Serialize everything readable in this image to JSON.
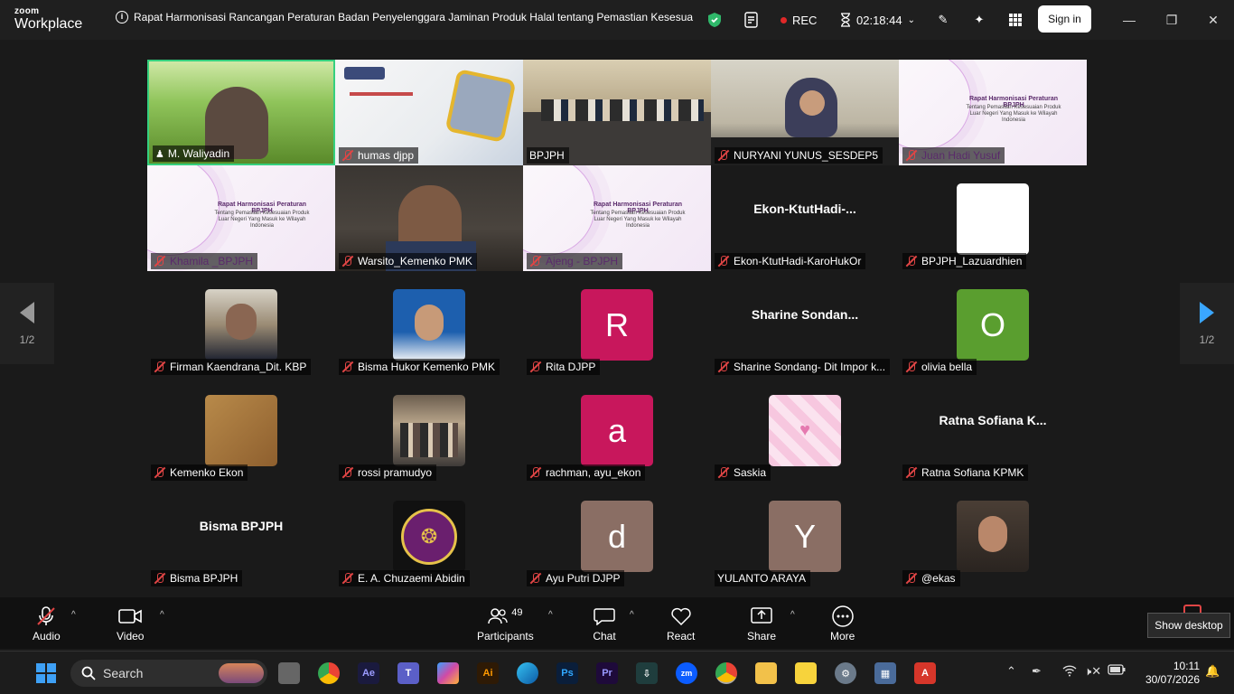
{
  "titlebar": {
    "brand_top": "zoom",
    "brand_bottom": "Workplace",
    "meeting_title": "Rapat Harmonisasi Rancangan Peraturan Badan Penyelenggara Jaminan Produk Halal tentang Pemastian Kesesua",
    "rec_label": "REC",
    "timer": "02:18:44",
    "signin_label": "Sign in"
  },
  "gallery": {
    "page_indicator": "1/2",
    "tiles": [
      {
        "name": "M. Waliyadin",
        "kind": "video"
      },
      {
        "name": "humas djpp",
        "kind": "video"
      },
      {
        "name": "BPJPH",
        "kind": "video"
      },
      {
        "name": "NURYANI YUNUS_SESDEP5",
        "kind": "video"
      },
      {
        "name": "Juan Hadi Yusuf",
        "kind": "slide"
      },
      {
        "name": "Khamila _BPJPH",
        "kind": "slide"
      },
      {
        "name": "Warsito_Kemenko PMK",
        "kind": "video"
      },
      {
        "name": "Ajeng - BPJPH",
        "kind": "slide"
      },
      {
        "name": "Ekon-KtutHadi-KaroHukOr",
        "display": "Ekon-KtutHadi-...",
        "kind": "name"
      },
      {
        "name": "BPJPH_Lazuardhien",
        "kind": "avatar",
        "color": "#ffffff",
        "letter": ""
      },
      {
        "name": "Firman Kaendrana_Dit. KBP",
        "kind": "photo"
      },
      {
        "name": "Bisma Hukor Kemenko PMK",
        "kind": "photo"
      },
      {
        "name": "Rita DJPP",
        "kind": "avatar",
        "color": "#c8175c",
        "letter": "R"
      },
      {
        "name": "Sharine Sondang- Dit Impor k...",
        "display": "Sharine  Sondan...",
        "kind": "name"
      },
      {
        "name": "olivia bella",
        "kind": "avatar",
        "color": "#5a9e2f",
        "letter": "O"
      },
      {
        "name": "Kemenko Ekon",
        "kind": "avatar",
        "color": "#a8783e",
        "letter": ""
      },
      {
        "name": "rossi pramudyo",
        "kind": "photo"
      },
      {
        "name": "rachman, ayu_ekon",
        "kind": "avatar",
        "color": "#c8175c",
        "letter": "a"
      },
      {
        "name": "Saskia",
        "kind": "avatar",
        "color": "#f4c6dd",
        "letter": ""
      },
      {
        "name": "Ratna Sofiana KPMK",
        "display": "Ratna Sofiana K...",
        "kind": "name"
      },
      {
        "name": "Bisma  BPJPH",
        "display": "Bisma  BPJPH",
        "kind": "name"
      },
      {
        "name": "E. A. Chuzaemi Abidin",
        "kind": "logo"
      },
      {
        "name": "Ayu Putri DJPP",
        "kind": "avatar",
        "color": "#8a6e64",
        "letter": "d"
      },
      {
        "name": "YULANTO ARAYA",
        "kind": "avatar",
        "color": "#8a6e64",
        "letter": "Y"
      },
      {
        "name": "@ekas",
        "kind": "photo"
      }
    ],
    "slide_text": {
      "title": "Rapat Harmonisasi Peraturan BPJPH",
      "subtitle": "Tentang Pemastian Kesesuaian Produk Luar Negeri Yang Masuk ke Wilayah Indonesia"
    }
  },
  "toolbar": {
    "audio": "Audio",
    "video": "Video",
    "participants": "Participants",
    "participants_count": "49",
    "chat": "Chat",
    "react": "React",
    "share": "Share",
    "more": "More",
    "tooltip": "Show desktop"
  },
  "taskbar": {
    "search_placeholder": "Search",
    "time": "10:11",
    "date": "30/07/2026"
  }
}
